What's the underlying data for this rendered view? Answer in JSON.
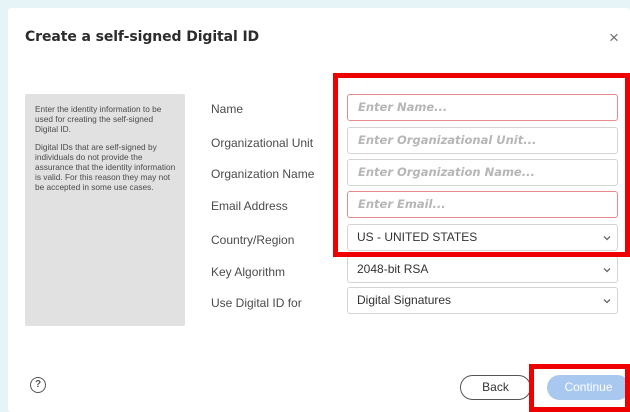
{
  "dialog": {
    "title": "Create a self-signed Digital ID",
    "close_symbol": "×"
  },
  "info_panel": {
    "paragraph1": "Enter the identity information to be used for creating the self-signed Digital ID.",
    "paragraph2": "Digital IDs that are self-signed by individuals do not provide the assurance that the identity information is valid. For this reason they may not be accepted in some use cases."
  },
  "form": {
    "name_label": "Name",
    "name_placeholder": "Enter Name...",
    "org_unit_label": "Organizational Unit",
    "org_unit_placeholder": "Enter Organizational Unit...",
    "org_name_label": "Organization Name",
    "org_name_placeholder": "Enter Organization Name...",
    "email_label": "Email Address",
    "email_placeholder": "Enter Email...",
    "country_label": "Country/Region",
    "country_value": "US - UNITED STATES",
    "key_algorithm_label": "Key Algorithm",
    "key_algorithm_value": "2048-bit RSA",
    "use_for_label": "Use Digital ID for",
    "use_for_value": "Digital Signatures"
  },
  "footer": {
    "help_symbol": "?",
    "back_label": "Back",
    "continue_label": "Continue"
  },
  "colors": {
    "highlight": "#ee0000",
    "error_border": "#e88b8b",
    "continue_bg": "#a9c8ef"
  },
  "icons": [
    "close-icon",
    "chevron-down-icon",
    "help-icon"
  ]
}
